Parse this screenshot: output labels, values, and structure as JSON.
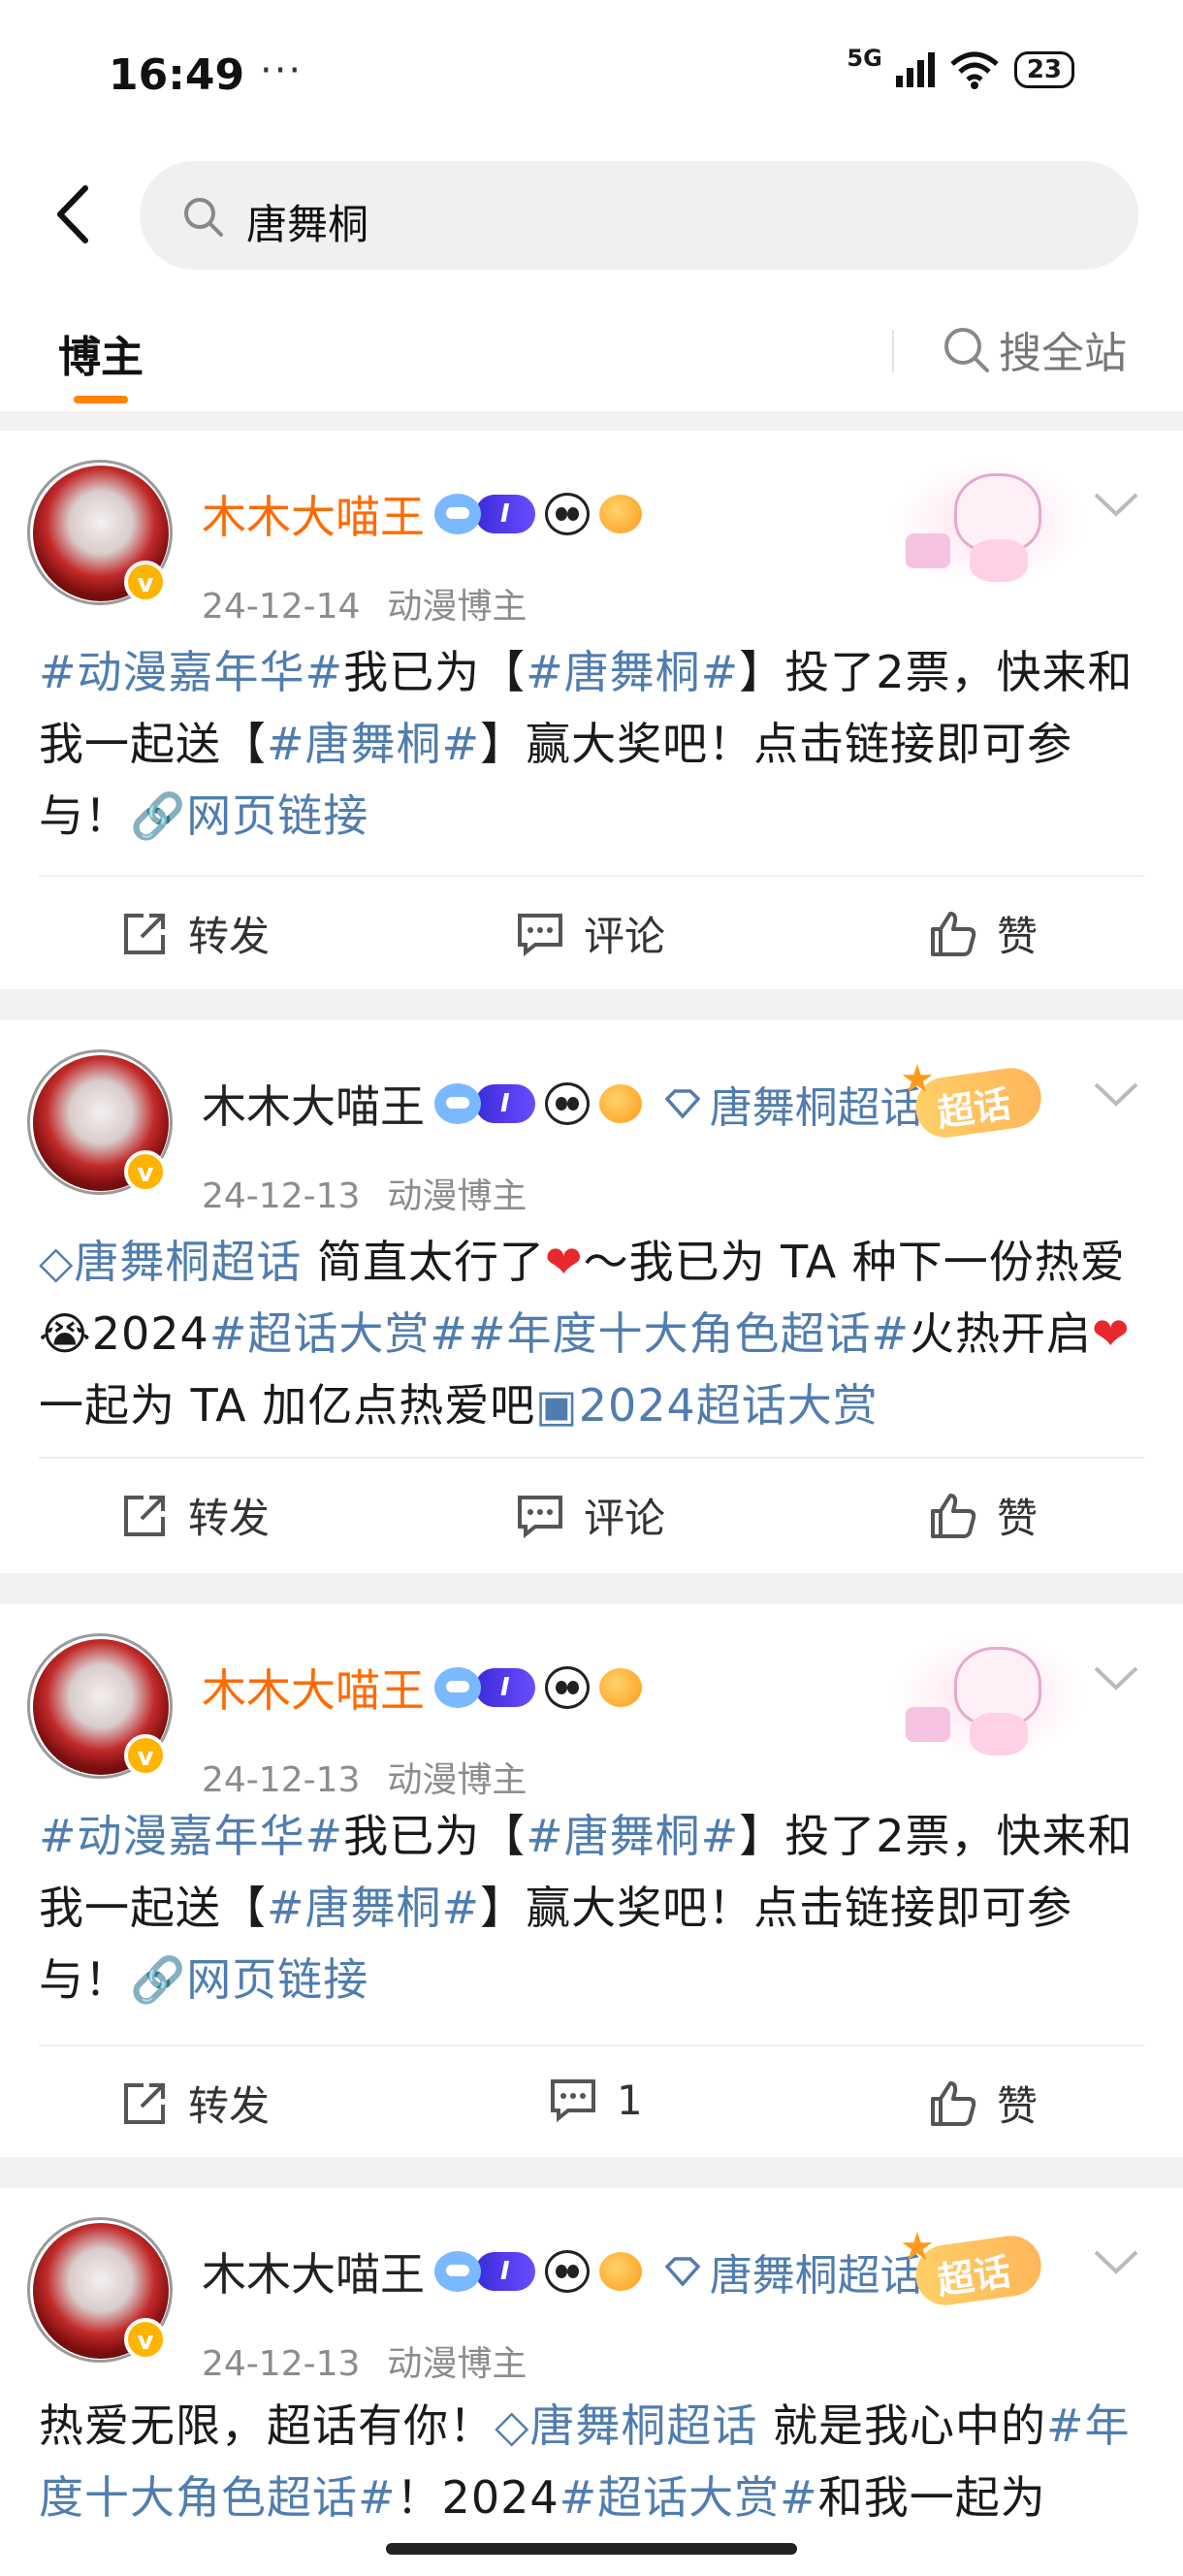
{
  "status_bar": {
    "time": "16:49",
    "dots": "···",
    "network": "5G",
    "battery": "23"
  },
  "search": {
    "query": "唐舞桐"
  },
  "tabs": {
    "active": "博主",
    "search_all": "搜全站"
  },
  "actions": {
    "repost": "转发",
    "comment": "评论",
    "like": "赞"
  },
  "posts": [
    {
      "username": "木木大喵王",
      "date": "24-12-14",
      "tag": "动漫博主",
      "level": "I",
      "text": [
        {
          "t": "#动漫嘉年华#",
          "hl": true
        },
        {
          "t": "我已为【"
        },
        {
          "t": "#唐舞桐#",
          "hl": true
        },
        {
          "t": "】投了2票，快来和我一起送【"
        },
        {
          "t": "#唐舞桐#",
          "hl": true
        },
        {
          "t": "】赢大奖吧！点击链接即可参与！"
        },
        {
          "t": "🔗网页链接",
          "hl": true
        }
      ],
      "comment_label": "评论"
    },
    {
      "username": "木木大喵王",
      "date": "24-12-13",
      "tag": "动漫博主",
      "level": "I",
      "topic": "唐舞桐超话",
      "deco_label": "超话",
      "text": [
        {
          "t": "◇唐舞桐超话",
          "hl": true
        },
        {
          "t": " 简直太行了"
        },
        {
          "t": "❤",
          "heart": true
        },
        {
          "t": "～我已为 TA 种下一份热爱😭2024"
        },
        {
          "t": "#超话大赏##年度十大角色超话#",
          "hl": true
        },
        {
          "t": "火热开启"
        },
        {
          "t": "❤",
          "heart": true
        },
        {
          "t": "一起为 TA 加亿点热爱吧"
        },
        {
          "t": "▣2024超话大赏",
          "hl": true
        }
      ],
      "comment_label": "评论"
    },
    {
      "username": "木木大喵王",
      "date": "24-12-13",
      "tag": "动漫博主",
      "level": "I",
      "text": [
        {
          "t": "#动漫嘉年华#",
          "hl": true
        },
        {
          "t": "我已为【"
        },
        {
          "t": "#唐舞桐#",
          "hl": true
        },
        {
          "t": "】投了2票，快来和我一起送【"
        },
        {
          "t": "#唐舞桐#",
          "hl": true
        },
        {
          "t": "】赢大奖吧！点击链接即可参与！"
        },
        {
          "t": "🔗网页链接",
          "hl": true
        }
      ],
      "comment_label": "1"
    },
    {
      "username": "木木大喵王",
      "date": "24-12-13",
      "tag": "动漫博主",
      "level": "I",
      "topic": "唐舞桐超话",
      "deco_label": "超话",
      "text": [
        {
          "t": "热爱无限，超话有你！"
        },
        {
          "t": "◇唐舞桐超话",
          "hl": true
        },
        {
          "t": " 就是我心中的"
        },
        {
          "t": "#年度十大角色超话#",
          "hl": true
        },
        {
          "t": "！2024"
        },
        {
          "t": "#超话大赏#",
          "hl": true
        },
        {
          "t": "和我一起为"
        }
      ]
    }
  ]
}
